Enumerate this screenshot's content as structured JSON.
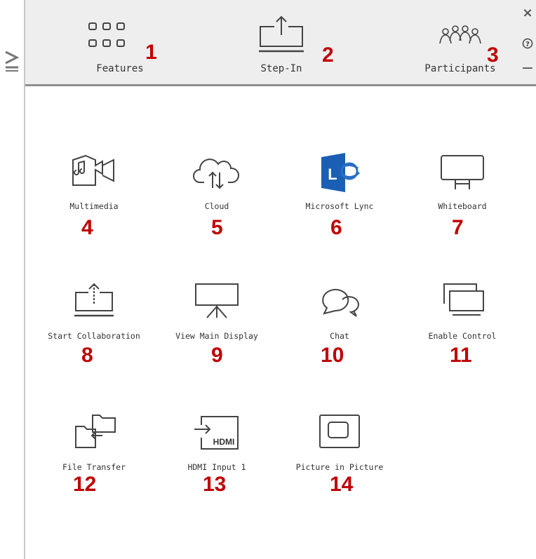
{
  "header": {
    "tabs": [
      {
        "label": "Features",
        "icon": "grid-icon",
        "number": "1"
      },
      {
        "label": "Step-In",
        "icon": "upload-tray-icon",
        "number": "2"
      },
      {
        "label": "Participants",
        "icon": "people-icon",
        "number": "3"
      }
    ],
    "window_controls": {
      "close": "×",
      "help": "?",
      "minimize": "−"
    }
  },
  "features": [
    {
      "label": "Multimedia",
      "icon": "multimedia-icon",
      "number": "4"
    },
    {
      "label": "Cloud",
      "icon": "cloud-icon",
      "number": "5"
    },
    {
      "label": "Microsoft Lync",
      "icon": "lync-icon",
      "number": "6"
    },
    {
      "label": "Whiteboard",
      "icon": "whiteboard-icon",
      "number": "7"
    },
    {
      "label": "Start Collaboration",
      "icon": "start-collaboration-icon",
      "number": "8"
    },
    {
      "label": "View Main Display",
      "icon": "main-display-icon",
      "number": "9"
    },
    {
      "label": "Chat",
      "icon": "chat-icon",
      "number": "10"
    },
    {
      "label": "Enable Control",
      "icon": "enable-control-icon",
      "number": "11"
    },
    {
      "label": "File Transfer",
      "icon": "file-transfer-icon",
      "number": "12"
    },
    {
      "label": "HDMI Input 1",
      "icon": "hdmi-input-icon",
      "number": "13",
      "icon_text": "HDMI"
    },
    {
      "label": "Picture in Picture",
      "icon": "picture-in-picture-icon",
      "number": "14"
    }
  ],
  "colors": {
    "annotation": "#c00000",
    "lync_blue": "#1a5fb4",
    "topbar": "#eeeeee"
  }
}
